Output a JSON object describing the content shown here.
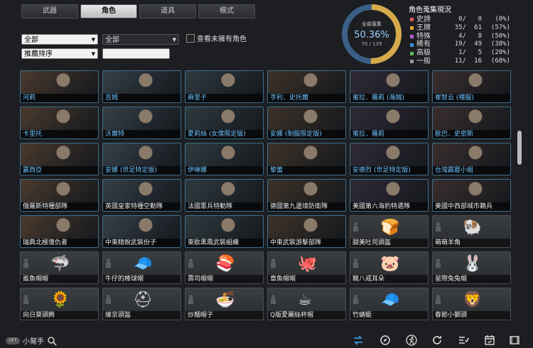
{
  "tabs": [
    {
      "label": "武器",
      "active": false
    },
    {
      "label": "角色",
      "active": true
    },
    {
      "label": "道具",
      "active": false
    },
    {
      "label": "模式",
      "active": false
    }
  ],
  "filters": {
    "category_value": "全部",
    "subcategory_value": "全部",
    "sort_value": "推薦排序",
    "search_value": "",
    "show_unowned_label": "查看未擁有角色"
  },
  "collection": {
    "ring_label": "全部蒐集",
    "percent": "50.36%",
    "fraction": "70 / 139",
    "progress": 0.5036,
    "title": "角色蒐集現況",
    "rows": [
      {
        "name": "史詩",
        "owned": "0/",
        "total": "0",
        "pct": "(0%)",
        "color": "#e05858"
      },
      {
        "name": "王牌",
        "owned": "35/",
        "total": "61",
        "pct": "(57%)",
        "color": "#e9a233"
      },
      {
        "name": "特殊",
        "owned": "4/",
        "total": "8",
        "pct": "(50%)",
        "color": "#b45fd6"
      },
      {
        "name": "稀有",
        "owned": "19/",
        "total": "49",
        "pct": "(38%)",
        "color": "#3f8fd8"
      },
      {
        "name": "高級",
        "owned": "1/",
        "total": "5",
        "pct": "(20%)",
        "color": "#5ab85a"
      },
      {
        "name": "一般",
        "owned": "11/",
        "total": "16",
        "pct": "(68%)",
        "color": "#9a9a9a"
      }
    ]
  },
  "colors": {
    "owned_border": "#3c6e8c",
    "ring_track": "#3b5f86",
    "ring_fill": "#d6a94a"
  },
  "cells": [
    {
      "name": "河莉",
      "owned": true,
      "variant": "blue"
    },
    {
      "name": "吉姆",
      "owned": true,
      "variant": "blue"
    },
    {
      "name": "麻里子",
      "owned": true,
      "variant": "blue"
    },
    {
      "name": "亨利．史托爾",
      "owned": true,
      "variant": "blue"
    },
    {
      "name": "蜜拉．羅莉 (海賊)",
      "owned": true,
      "variant": "blue"
    },
    {
      "name": "崔智云 (禮服)",
      "owned": true,
      "variant": "blue"
    },
    {
      "name": "卡里托",
      "owned": true,
      "variant": "blue"
    },
    {
      "name": "沃爾特",
      "owned": true,
      "variant": "blue"
    },
    {
      "name": "愛莉絲 (女僕限定版)",
      "owned": true,
      "variant": "blue"
    },
    {
      "name": "安娜 (制服限定版)",
      "owned": true,
      "variant": "blue"
    },
    {
      "name": "蜜拉．羅莉",
      "owned": true,
      "variant": "blue"
    },
    {
      "name": "歐巴．史密斯",
      "owned": true,
      "variant": "blue"
    },
    {
      "name": "露西亞",
      "owned": true,
      "variant": "blue"
    },
    {
      "name": "安娜 (世足特定版)",
      "owned": true,
      "variant": "blue"
    },
    {
      "name": "伊琳娜",
      "owned": true,
      "variant": "blue"
    },
    {
      "name": "黎蕾",
      "owned": true,
      "variant": "blue"
    },
    {
      "name": "安德烈 (世足特定版)",
      "owned": true,
      "variant": "blue"
    },
    {
      "name": "台灣霹靂小組",
      "owned": true,
      "variant": "blue"
    },
    {
      "name": "俄羅斯特種部隊",
      "owned": true,
      "variant": "white"
    },
    {
      "name": "英國皇家特種空勤隊",
      "owned": true,
      "variant": "white"
    },
    {
      "name": "法國憲兵特勤隊",
      "owned": true,
      "variant": "white"
    },
    {
      "name": "德國第九邊境防衛隊",
      "owned": true,
      "variant": "white"
    },
    {
      "name": "美國第六海豹特遣隊",
      "owned": true,
      "variant": "white"
    },
    {
      "name": "美國中西部城市鵜兵",
      "owned": true,
      "variant": "white"
    },
    {
      "name": "瑞典北極復仇者",
      "owned": true,
      "variant": "white"
    },
    {
      "name": "中東精銳武裝份子",
      "owned": true,
      "variant": "white"
    },
    {
      "name": "東歐黑鳳武裝組織",
      "owned": true,
      "variant": "white"
    },
    {
      "name": "中東武裝游擊部隊",
      "owned": true,
      "variant": "white"
    },
    {
      "name": "甜美吐司頭盔",
      "owned": false,
      "icon": "toast-icon",
      "glyph": "🍞"
    },
    {
      "name": "萌萌羊角",
      "owned": false,
      "icon": "ram-horns-icon",
      "glyph": "🐏"
    },
    {
      "name": "鯊魚帽帽",
      "owned": false,
      "icon": "shark-hat-icon",
      "glyph": "🦈"
    },
    {
      "name": "牛仔的棒球帽",
      "owned": false,
      "icon": "sheriff-cap-icon",
      "glyph": "🧢"
    },
    {
      "name": "壽司帽帽",
      "owned": false,
      "icon": "sushi-hat-icon",
      "glyph": "🍣"
    },
    {
      "name": "章魚帽帽",
      "owned": false,
      "icon": "octopus-hat-icon",
      "glyph": "🐙"
    },
    {
      "name": "豬八戒耳朵",
      "owned": false,
      "icon": "pig-ears-icon",
      "glyph": "🐷"
    },
    {
      "name": "星際兔兔帽",
      "owned": false,
      "icon": "space-bunny-hat-icon",
      "glyph": "🐰"
    },
    {
      "name": "向日葵頭飾",
      "owned": false,
      "icon": "sunflower-icon",
      "glyph": "🌻"
    },
    {
      "name": "維京頭盔",
      "owned": false,
      "icon": "viking-helmet-icon",
      "glyph": "⛑"
    },
    {
      "name": "炒麵帽子",
      "owned": false,
      "icon": "noodle-hat-icon",
      "glyph": "🍜"
    },
    {
      "name": "Q版愛麗絲杯帽",
      "owned": false,
      "icon": "teacup-hat-icon",
      "glyph": "☕"
    },
    {
      "name": "竹蜻蜓",
      "owned": false,
      "icon": "propeller-cap-icon",
      "glyph": "🧢"
    },
    {
      "name": "春節小獅頭",
      "owned": false,
      "icon": "lion-head-icon",
      "glyph": "🦁"
    }
  ],
  "bottom": {
    "toggle_label": "OFF",
    "helper_label": "小幫手"
  }
}
